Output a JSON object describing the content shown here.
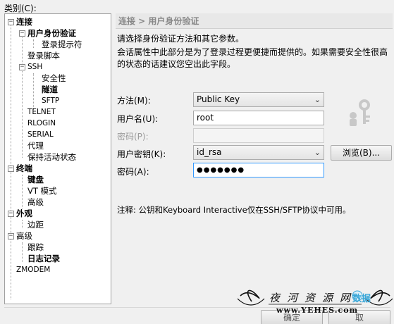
{
  "category_label": "类别(C):",
  "tree": {
    "items": [
      {
        "label": "连接",
        "bold": true
      },
      {
        "label": "用户身份验证",
        "bold": true
      },
      {
        "label": "登录提示符"
      },
      {
        "label": "登录脚本"
      },
      {
        "label": "SSH",
        "small": true
      },
      {
        "label": "安全性"
      },
      {
        "label": "隧道",
        "bold": true
      },
      {
        "label": "SFTP",
        "small": true
      },
      {
        "label": "TELNET",
        "small": true
      },
      {
        "label": "RLOGIN",
        "small": true
      },
      {
        "label": "SERIAL",
        "small": true
      },
      {
        "label": "代理"
      },
      {
        "label": "保持活动状态"
      },
      {
        "label": "终端",
        "bold": true
      },
      {
        "label": "键盘",
        "bold": true
      },
      {
        "label": "VT 模式"
      },
      {
        "label": "高级"
      },
      {
        "label": "外观",
        "bold": true
      },
      {
        "label": "边距"
      },
      {
        "label": "高级"
      },
      {
        "label": "跟踪"
      },
      {
        "label": "日志记录",
        "bold": true
      },
      {
        "label": "ZMODEM",
        "small": true
      }
    ],
    "expanders": [
      "−",
      "−",
      "−",
      "−",
      "−",
      "−"
    ]
  },
  "panel": {
    "breadcrumb": "连接 > 用户身份验证",
    "desc1": "请选择身份验证方法和其它参数。",
    "desc2": "会话属性中此部分是为了登录过程更便捷而提供的。如果需要安全性很高",
    "desc3": "的状态的话建议您空出此字段。"
  },
  "form": {
    "method_label": "方法(M):",
    "method_value": "Public Key",
    "username_label": "用户名(U):",
    "username_value": "root",
    "password_label": "密码(P):",
    "password_value": "",
    "userkey_label": "用户密钥(K):",
    "userkey_value": "id_rsa",
    "browse_label": "浏览(B)...",
    "passphrase_label": "密码(A):",
    "passphrase_value": "●●●●●●●"
  },
  "note": "注释: 公钥和Keyboard Interactive仅在SSH/SFTP协议中可用。",
  "footer": {
    "ok_label": "确定",
    "cancel_label": "取"
  },
  "watermark": {
    "title": "夜河资源网",
    "url": "www.YEHES.com",
    "badge": "数据"
  },
  "colors": {
    "focus_border": "#3399ff",
    "header_text": "#888888",
    "watermark_badge": "#3aa7d8"
  }
}
